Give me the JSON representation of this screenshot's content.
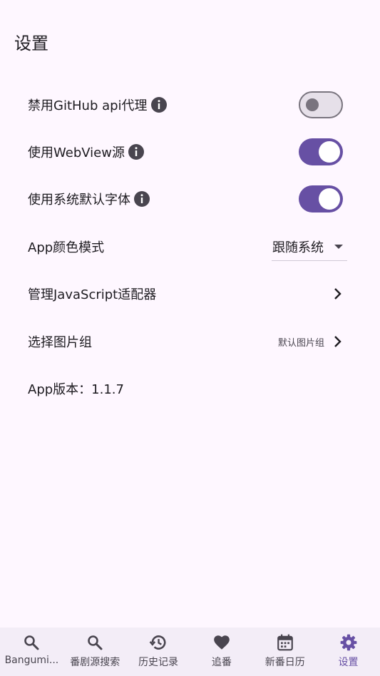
{
  "page": {
    "title": "设置"
  },
  "settings": [
    {
      "label": "禁用GitHub api代理",
      "info": true,
      "control": "switch",
      "on": false
    },
    {
      "label": "使用WebView源",
      "info": true,
      "control": "switch",
      "on": true
    },
    {
      "label": "使用系统默认字体",
      "info": true,
      "control": "switch",
      "on": true
    },
    {
      "label": "App颜色模式",
      "control": "dropdown",
      "value": "跟随系统"
    },
    {
      "label": "管理JavaScript适配器",
      "control": "chevron"
    },
    {
      "label": "选择图片组",
      "control": "chevron",
      "value": "默认图片组"
    },
    {
      "label": "App版本：1.1.7",
      "control": "none"
    }
  ],
  "nav": {
    "items": [
      {
        "label": "Bangumi...",
        "icon": "search-icon"
      },
      {
        "label": "番剧源搜索",
        "icon": "search-icon"
      },
      {
        "label": "历史记录",
        "icon": "history-icon"
      },
      {
        "label": "追番",
        "icon": "heart-icon"
      },
      {
        "label": "新番日历",
        "icon": "calendar-icon"
      },
      {
        "label": "设置",
        "icon": "gear-icon",
        "active": true
      }
    ]
  },
  "colors": {
    "primary": "#6750A4",
    "background": "#FEF7FF",
    "nav_background": "#F3EDF7"
  }
}
